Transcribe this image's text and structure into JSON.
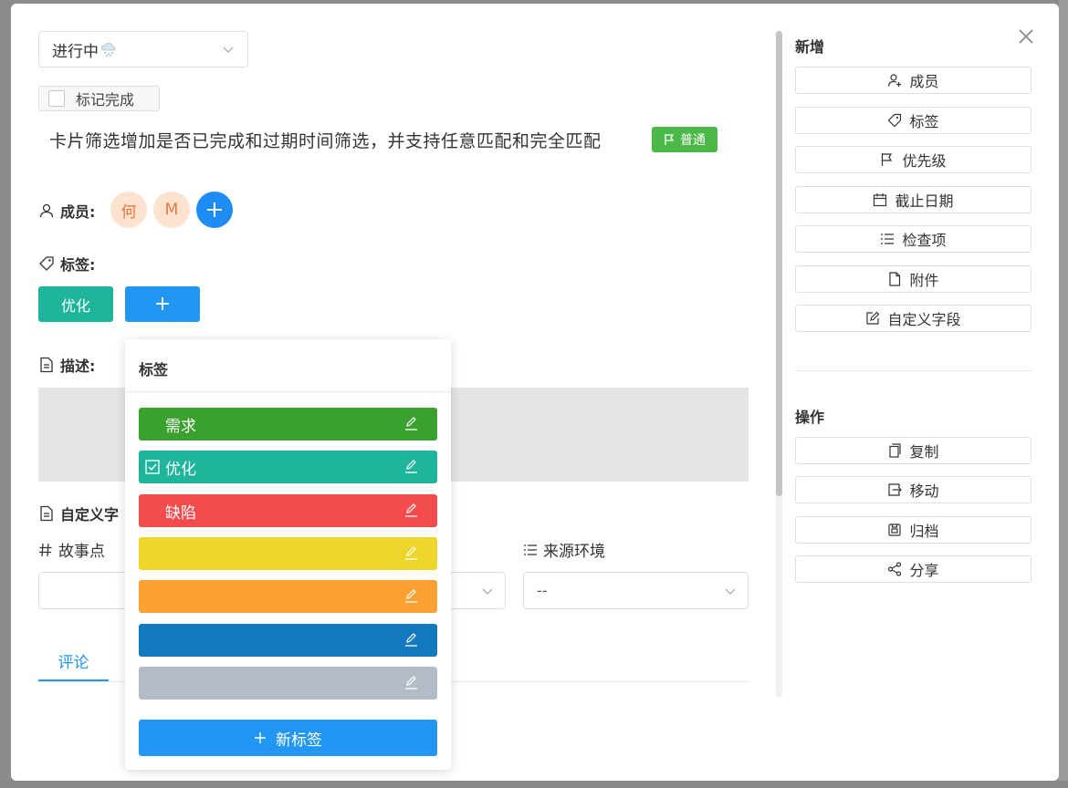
{
  "status": {
    "value": "进行中"
  },
  "mark_done": {
    "label": "标记完成"
  },
  "card": {
    "title": "卡片筛选增加是否已完成和过期时间筛选，并支持任意匹配和完全匹配",
    "priority": "普通"
  },
  "members": {
    "label": "成员:",
    "avatars": [
      "何",
      "M"
    ]
  },
  "tags": {
    "label": "标签:",
    "current": "优化",
    "add_label": "+"
  },
  "description": {
    "label": "描述:"
  },
  "custom_fields": {
    "label": "自定义字",
    "story_points_label": "故事点",
    "source_env_label": "来源环境",
    "source_env_value": "--"
  },
  "tabs": {
    "comment": "评论"
  },
  "sidebar": {
    "add_title": "新增",
    "add_buttons": [
      "成员",
      "标签",
      "优先级",
      "截止日期",
      "检查项",
      "附件",
      "自定义字段"
    ],
    "ops_title": "操作",
    "ops_buttons": [
      "复制",
      "移动",
      "归档",
      "分享"
    ]
  },
  "tag_popover": {
    "title": "标签",
    "tags": [
      {
        "name": "需求",
        "color": "#3aa12f",
        "checked": false
      },
      {
        "name": "优化",
        "color": "#1fb59c",
        "checked": true
      },
      {
        "name": "缺陷",
        "color": "#f44c4c",
        "checked": false
      },
      {
        "name": "",
        "color": "#eed52b",
        "checked": false
      },
      {
        "name": "",
        "color": "#fda133",
        "checked": false
      },
      {
        "name": "",
        "color": "#1478be",
        "checked": false
      },
      {
        "name": "",
        "color": "#b3bcc6",
        "checked": false
      }
    ],
    "new_tag_label": "新标签"
  },
  "colors": {
    "primary": "#2196f3",
    "priority_green": "#4cb848",
    "tag_teal": "#1fb59c"
  }
}
